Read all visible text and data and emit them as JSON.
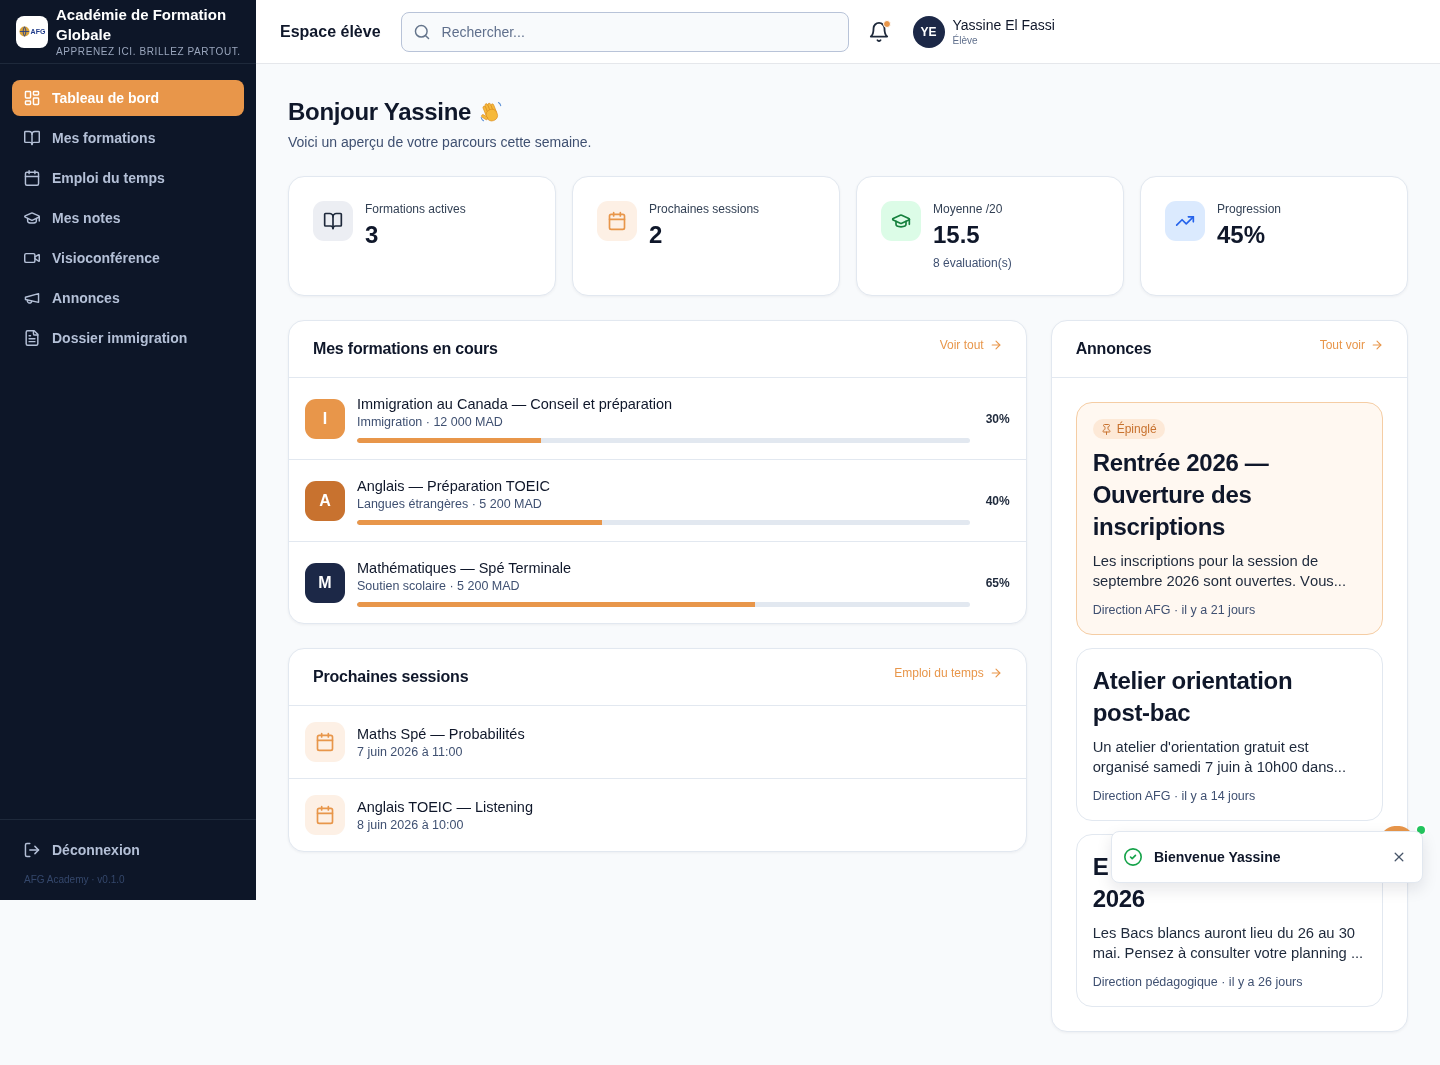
{
  "sidebar": {
    "logo_text": "AFG",
    "brand": "Académie de Formation Globale",
    "tagline": "APPRENEZ ICI. BRILLEZ PARTOUT.",
    "items": [
      {
        "kind": "dashboard",
        "label": "Tableau de bord",
        "selected": true
      },
      {
        "kind": "courses",
        "label": "Mes formations",
        "selected": false
      },
      {
        "kind": "schedule",
        "label": "Emploi du temps",
        "selected": false
      },
      {
        "kind": "grades",
        "label": "Mes notes",
        "selected": false
      },
      {
        "kind": "video",
        "label": "Visioconférence",
        "selected": false
      },
      {
        "kind": "announcements",
        "label": "Annonces",
        "selected": false
      },
      {
        "kind": "documents",
        "label": "Dossier immigration",
        "selected": false
      }
    ],
    "logout": "Déconnexion",
    "version": "AFG Academy · v0.1.0"
  },
  "header": {
    "title": "Espace élève",
    "search": {
      "placeholder": "Rechercher..."
    },
    "notifications": {
      "unread": true
    },
    "user": {
      "initials": "YE",
      "name": "Yassine El Fassi",
      "role": "Élève"
    }
  },
  "greeting": {
    "title": "Bonjour Yassine",
    "subtitle": "Voici un aperçu de votre parcours cette semaine."
  },
  "stats": [
    {
      "kind": "courses",
      "label": "Formations actives",
      "value": "3"
    },
    {
      "kind": "sessions",
      "label": "Prochaines sessions",
      "value": "2"
    },
    {
      "kind": "average",
      "label": "Moyenne /20",
      "value": "15.5",
      "note": "8 évaluation(s)"
    },
    {
      "kind": "progress",
      "label": "Progression",
      "value": "45%"
    }
  ],
  "courses": {
    "title": "Mes formations en cours",
    "link": "Voir tout",
    "items": [
      {
        "initial": "I",
        "color": "#e8964a",
        "title": "Immigration au Canada — Conseil et préparation",
        "meta": "Immigration · 12 000 MAD",
        "level": 0.3,
        "reading": "30%"
      },
      {
        "initial": "A",
        "color": "#c8722f",
        "title": "Anglais — Préparation TOEIC",
        "meta": "Langues étrangères · 5 200 MAD",
        "level": 0.4,
        "reading": "40%"
      },
      {
        "initial": "M",
        "color": "#1c2847",
        "title": "Mathématiques — Spé Terminale",
        "meta": "Soutien scolaire · 5 200 MAD",
        "level": 0.65,
        "reading": "65%"
      }
    ]
  },
  "sessions": {
    "title": "Prochaines sessions",
    "link": "Emploi du temps",
    "items": [
      {
        "title": "Maths Spé — Probabilités",
        "date": "7 juin 2026 à 11:00"
      },
      {
        "title": "Anglais TOEIC — Listening",
        "date": "8 juin 2026 à 10:00"
      }
    ]
  },
  "announcements": {
    "title": "Annonces",
    "link": "Tout voir",
    "items": [
      {
        "pinned": true,
        "badge": "Épinglé",
        "title": "Rentrée 2026 — Ouverture des inscriptions",
        "excerpt": "Les inscriptions pour la session de septembre 2026 sont ouvertes. Vous...",
        "meta": "Direction AFG · il y a 21 jours"
      },
      {
        "pinned": false,
        "title": "Atelier orientation post-bac",
        "excerpt": "Un atelier d'orientation gratuit est organisé samedi 7 juin à 10h00 dans...",
        "meta": "Direction AFG · il y a 14 jours"
      },
      {
        "pinned": false,
        "title_lines": [
          "E",
          "2026"
        ],
        "excerpt": "Les Bacs blancs auront lieu du 26 au 30 mai. Pensez à consulter votre planning ...",
        "meta": "Direction pédagogique · il y a 26 jours"
      }
    ]
  },
  "toast": {
    "message": "Bienvenue Yassine"
  },
  "floating": {
    "online": true
  }
}
